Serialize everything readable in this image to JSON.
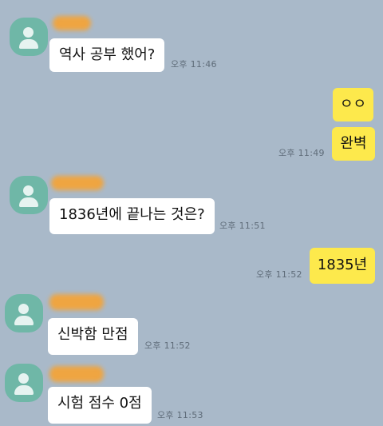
{
  "messages": [
    {
      "side": "left",
      "text": "역사 공부 했어?",
      "time": "오후 11:46"
    },
    {
      "side": "right",
      "text": "ㅇㅇ",
      "time": ""
    },
    {
      "side": "right",
      "text": "완벽",
      "time": "오후 11:49"
    },
    {
      "side": "left",
      "text": "1836년에 끝나는 것은?",
      "time": "오후 11:51"
    },
    {
      "side": "right",
      "text": "1835년",
      "time": "오후 11:52"
    },
    {
      "side": "left",
      "text": "신박함 만점",
      "time": "오후 11:52"
    },
    {
      "side": "left",
      "text": "시험 점수 0점",
      "time": "오후 11:53"
    }
  ],
  "colors": {
    "background": "#a9b9c9",
    "incoming_bubble": "#ffffff",
    "outgoing_bubble": "#fde94c",
    "avatar": "#6fb7a7",
    "name_redaction": "#f3a43a"
  },
  "icons": {
    "avatar": "default-profile-avatar-icon"
  }
}
